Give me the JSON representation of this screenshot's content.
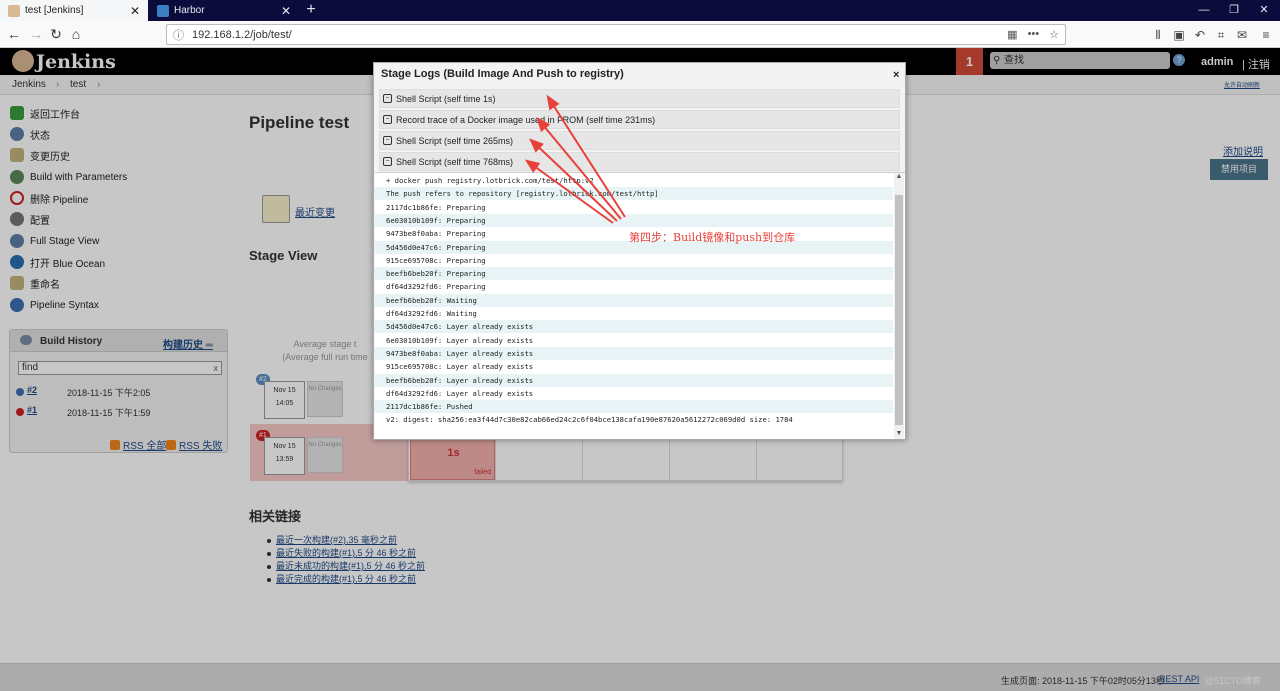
{
  "browser": {
    "tabs": [
      {
        "label": "test [Jenkins]",
        "active": true
      },
      {
        "label": "Harbor",
        "active": false
      }
    ],
    "url": "192.168.1.2/job/test/",
    "new_tab": "+",
    "window_controls": [
      "—",
      "❐",
      "✕"
    ]
  },
  "jenkins": {
    "title": "Jenkins",
    "notifications": "1",
    "search_placeholder": "查找",
    "user": "admin",
    "logout": "| 注销",
    "breadcrumb": [
      "Jenkins",
      "›",
      "test",
      "›"
    ],
    "auto_refresh": "允许自动刷新"
  },
  "sidebar": {
    "items": [
      {
        "label": "返回工作台",
        "icon": "arrow-up-icon",
        "color": "#3a9c3a"
      },
      {
        "label": "状态",
        "icon": "search-icon",
        "color": "#5b7ea8"
      },
      {
        "label": "变更历史",
        "icon": "notepad-icon",
        "color": "#c2b47a"
      },
      {
        "label": "Build with Parameters",
        "icon": "clock-icon",
        "color": "#5a8a5a"
      },
      {
        "label": "删除 Pipeline",
        "icon": "no-entry-icon",
        "color": "#cc2222"
      },
      {
        "label": "配置",
        "icon": "gear-icon",
        "color": "#777777"
      },
      {
        "label": "Full Stage View",
        "icon": "search-icon",
        "color": "#5b7ea8"
      },
      {
        "label": "打开 Blue Ocean",
        "icon": "blue-ocean-icon",
        "color": "#2a6fb0"
      },
      {
        "label": "重命名",
        "icon": "notepad-icon",
        "color": "#c2b47a"
      },
      {
        "label": "Pipeline Syntax",
        "icon": "help-icon",
        "color": "#3b6fb0"
      }
    ]
  },
  "build_history": {
    "title": "Build History",
    "trend_link": "构建历史 ═",
    "find_placeholder": "find",
    "find_clear": "x",
    "builds": [
      {
        "number": "#2",
        "date": "2018-11-15 下午2:05",
        "color": "#3b6fb0"
      },
      {
        "number": "#1",
        "date": "2018-11-15 下午1:59",
        "color": "#cc2222"
      }
    ],
    "rss_all": "RSS 全部",
    "rss_fail": "RSS 失败"
  },
  "main": {
    "title": "Pipeline test",
    "add_description": "添加说明",
    "disable_button": "禁用项目",
    "recent_changes": "最近变更",
    "stage_view": "Stage View",
    "average_stage_line1": "Average stage t",
    "average_stage_line2": "(Average full run time",
    "runs": [
      {
        "badge": "#2",
        "month": "Nov 15",
        "time": "14:05",
        "badge_color": "#5b8fc4"
      },
      {
        "badge": "#1",
        "month": "Nov 15",
        "time": "13:59",
        "badge_color": "#cc2222"
      }
    ],
    "no_changes": "No Changes",
    "failed_cell": {
      "time": "1s",
      "label": "failed"
    },
    "related_title": "相关链接",
    "related_links": [
      "最近一次构建(#2),35 毫秒之前",
      "最近失败的构建(#1),5 分 46 秒之前",
      "最近未成功的构建(#1),5 分 46 秒之前",
      "最近完成的构建(#1),5 分 46 秒之前"
    ]
  },
  "modal": {
    "title": "Stage Logs (Build Image And Push to registry)",
    "close": "×",
    "steps": [
      "Shell Script (self time 1s)",
      "Record trace of a Docker image used in FROM (self time 231ms)",
      "Shell Script (self time 265ms)",
      "Shell Script (self time 768ms)"
    ],
    "log_lines": [
      "+ docker push registry.lotbrick.com/test/http:v2",
      "The push refers to repository [registry.lotbrick.com/test/http]",
      "2117dc1b86fe: Preparing",
      "6e03010b109f: Preparing",
      "9473be8f0aba: Preparing",
      "5d456d0e47c6: Preparing",
      "915ce695708c: Preparing",
      "beefb6beb20f: Preparing",
      "df64d3292fd6: Preparing",
      "beefb6beb20f: Waiting",
      "df64d3292fd6: Waiting",
      "5d456d0e47c6: Layer already exists",
      "6e03010b109f: Layer already exists",
      "9473be8f0aba: Layer already exists",
      "915ce695708c: Layer already exists",
      "beefb6beb20f: Layer already exists",
      "df64d3292fd6: Layer already exists",
      "2117dc1b86fe: Pushed",
      "v2: digest: sha256:ea3f44d7c30e82cab66ed24c2c6f04bce138cafa190e87620a5612272c069d0d size: 1784"
    ]
  },
  "annotation": {
    "text": "第四步：Build镜像和push到仓库",
    "color": "#e8403a"
  },
  "footer": {
    "generated": "生成页面: 2018-11-15 下午02时05分13秒",
    "rest_api": "REST API",
    "watermark": "@51CTO博客"
  }
}
